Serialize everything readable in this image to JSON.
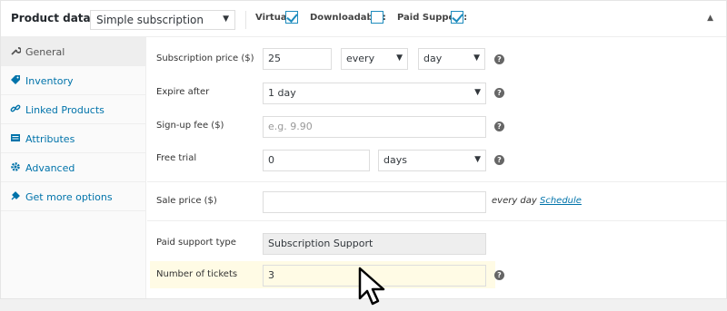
{
  "header": {
    "title": "Product data —",
    "product_type": "Simple subscription",
    "virtual_label": "Virtual:",
    "virtual_checked": true,
    "downloadable_label": "Downloadable:",
    "downloadable_checked": false,
    "paid_support_label": "Paid Support:",
    "paid_support_checked": true
  },
  "sidebar": {
    "items": [
      {
        "label": "General",
        "icon": "wrench-icon",
        "active": true
      },
      {
        "label": "Inventory",
        "icon": "tag-icon",
        "active": false
      },
      {
        "label": "Linked Products",
        "icon": "link-icon",
        "active": false
      },
      {
        "label": "Attributes",
        "icon": "list-icon",
        "active": false
      },
      {
        "label": "Advanced",
        "icon": "gear-icon",
        "active": false
      },
      {
        "label": "Get more options",
        "icon": "plugin-icon",
        "active": false
      }
    ]
  },
  "form": {
    "subscription_price_label": "Subscription price ($)",
    "subscription_price_value": "25",
    "interval_value": "every",
    "period_value": "day",
    "expire_label": "Expire after",
    "expire_value": "1 day",
    "signup_label": "Sign-up fee ($)",
    "signup_placeholder": "e.g. 9.90",
    "trial_label": "Free trial",
    "trial_value": "0",
    "trial_period_value": "days",
    "sale_label": "Sale price ($)",
    "sale_value": "",
    "sale_suffix": "every day",
    "schedule_link": "Schedule",
    "paid_support_type_label": "Paid support type",
    "paid_support_type_value": "Subscription Support",
    "tickets_label": "Number of tickets",
    "tickets_value": "3"
  },
  "help_glyph": "?",
  "colors": {
    "accent": "#0073aa",
    "checkbox": "#1e8cbe",
    "highlight": "#fffbe5"
  }
}
